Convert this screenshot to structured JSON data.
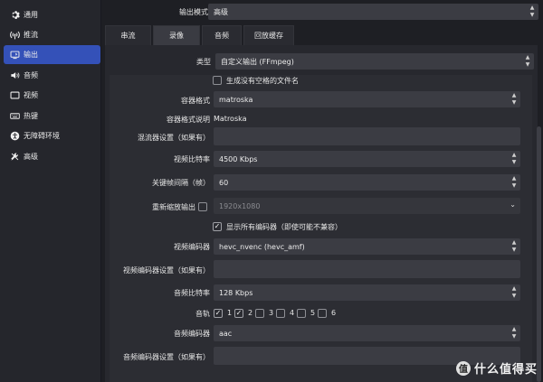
{
  "sidebar": {
    "items": [
      {
        "label": "通用",
        "icon": "gear-icon"
      },
      {
        "label": "推流",
        "icon": "antenna-icon"
      },
      {
        "label": "输出",
        "icon": "output-icon",
        "active": true
      },
      {
        "label": "音频",
        "icon": "speaker-icon"
      },
      {
        "label": "视频",
        "icon": "monitor-icon"
      },
      {
        "label": "热键",
        "icon": "keyboard-icon"
      },
      {
        "label": "无障碍环境",
        "icon": "accessibility-icon"
      },
      {
        "label": "高级",
        "icon": "tools-icon"
      }
    ]
  },
  "output_mode": {
    "label": "输出模式",
    "value": "高级"
  },
  "tabs": [
    "串流",
    "录像",
    "音频",
    "回放缓存"
  ],
  "type": {
    "label": "类型",
    "value": "自定义输出 (FFmpeg)"
  },
  "generate_filename": {
    "label": "生成没有空格的文件名"
  },
  "container_format": {
    "label": "容器格式",
    "value": "matroska"
  },
  "container_desc": {
    "label": "容器格式说明",
    "value": "Matroska"
  },
  "muxer_settings": {
    "label": "混流器设置（如果有）",
    "value": ""
  },
  "video_bitrate": {
    "label": "视频比特率",
    "value": "4500 Kbps"
  },
  "keyframe_interval": {
    "label": "关键帧间隔（帧）",
    "value": "60"
  },
  "rescale": {
    "label": "重新缩放输出",
    "value": "1920x1080"
  },
  "show_all_codecs": {
    "label": "显示所有编码器（即使可能不兼容）"
  },
  "video_encoder": {
    "label": "视频编码器",
    "value": "hevc_nvenc (hevc_amf)"
  },
  "video_encoder_settings": {
    "label": "视频编码器设置（如果有）",
    "value": ""
  },
  "audio_bitrate": {
    "label": "音频比特率",
    "value": "128 Kbps"
  },
  "audio_track": {
    "label": "音轨",
    "tracks": [
      "1",
      "2",
      "3",
      "4",
      "5",
      "6"
    ]
  },
  "audio_encoder": {
    "label": "音频编码器",
    "value": "aac"
  },
  "audio_encoder_settings": {
    "label": "音频编码器设置（如果有）",
    "value": ""
  },
  "watermark": {
    "badge": "值",
    "text": "什么值得买"
  }
}
